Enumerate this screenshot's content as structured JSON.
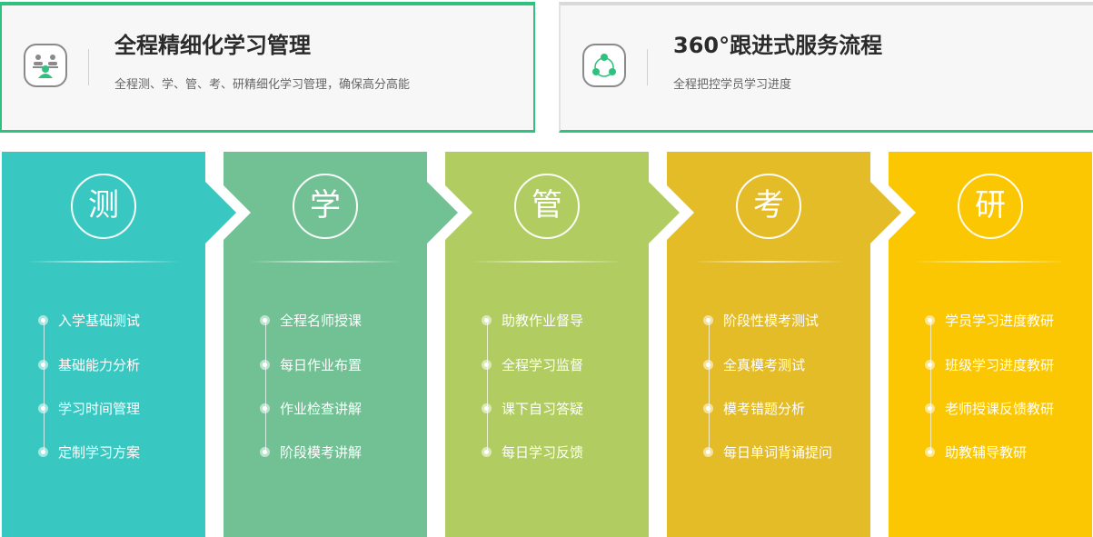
{
  "cards": [
    {
      "title": "全程精细化学习管理",
      "subtitle": "全程测、学、管、考、研精细化学习管理，确保高分高能",
      "icon": "students-icon"
    },
    {
      "title": "360°跟进式服务流程",
      "subtitle": "全程把控学员学习进度",
      "icon": "cycle-icon"
    }
  ],
  "columns": [
    {
      "char": "测",
      "color": "#39c8c1",
      "items": [
        "入学基础测试",
        "基础能力分析",
        "学习时间管理",
        "定制学习方案"
      ]
    },
    {
      "char": "学",
      "color": "#72c194",
      "items": [
        "全程名师授课",
        "每日作业布置",
        "作业检查讲解",
        "阶段模考讲解"
      ]
    },
    {
      "char": "管",
      "color": "#b1cd61",
      "items": [
        "助教作业督导",
        "全程学习监督",
        "课下自习答疑",
        "每日学习反馈"
      ]
    },
    {
      "char": "考",
      "color": "#e4bc28",
      "items": [
        "阶段性模考测试",
        "全真模考测试",
        "模考错题分析",
        "每日单词背诵提问"
      ]
    },
    {
      "char": "研",
      "color": "#fbc703",
      "items": [
        "学员学习进度教研",
        "班级学习进度教研",
        "老师授课反馈教研",
        "助教辅导教研"
      ]
    }
  ],
  "colors": {
    "accent": "#2fc27e",
    "card_bg": "#f7f7f7"
  }
}
